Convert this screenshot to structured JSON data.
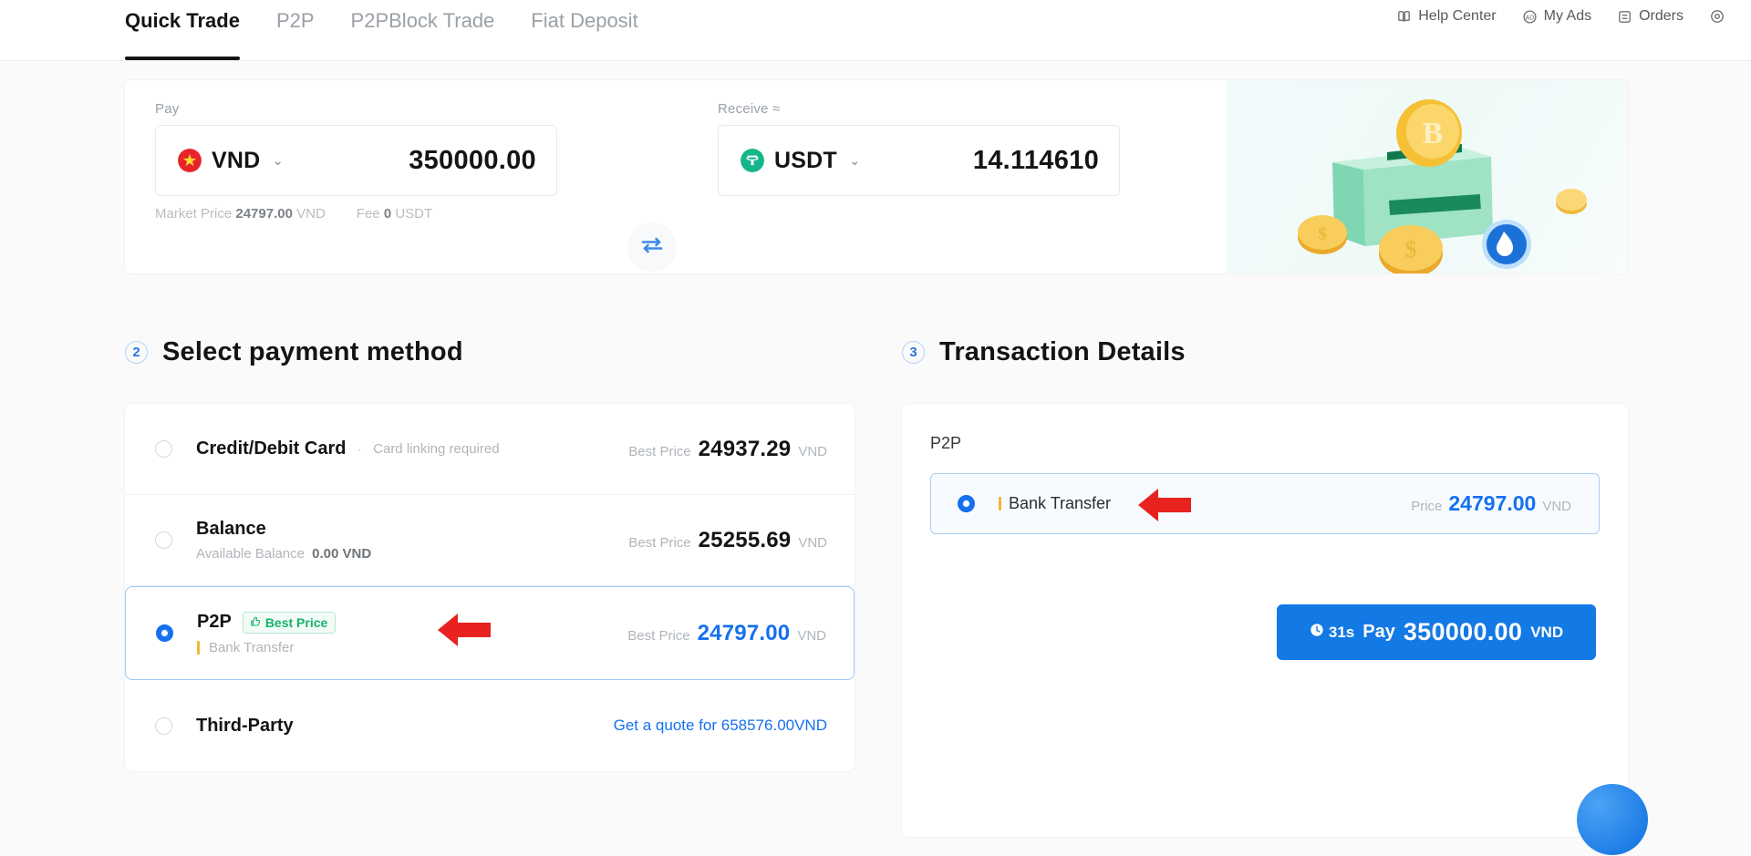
{
  "nav": {
    "tabs": [
      {
        "label": "Quick Trade",
        "active": true
      },
      {
        "label": "P2P",
        "active": false
      },
      {
        "label": "P2PBlock Trade",
        "active": false
      },
      {
        "label": "Fiat Deposit",
        "active": false
      }
    ],
    "right_items": [
      {
        "label": "Help Center",
        "icon": "book-icon"
      },
      {
        "label": "My Ads",
        "icon": "ads-icon"
      },
      {
        "label": "Orders",
        "icon": "orders-icon"
      }
    ],
    "settings_icon": "gear-icon"
  },
  "quote": {
    "pay": {
      "label": "Pay",
      "currency": "VND",
      "amount": "350000.00",
      "flag_icon": "vietnam-flag-icon"
    },
    "receive": {
      "label": "Receive ≈",
      "currency": "USDT",
      "amount": "14.114610",
      "coin_icon": "tether-icon"
    },
    "swap_icon": "swap-arrows-icon",
    "meta": {
      "market_price_label": "Market Price",
      "market_price_value": "24797.00",
      "market_price_unit": "VND",
      "fee_label": "Fee",
      "fee_value": "0",
      "fee_unit": "USDT"
    },
    "illustration": "money-box-coins-illustration"
  },
  "payment_section": {
    "step": "2",
    "title": "Select payment method",
    "methods": [
      {
        "name": "Credit/Debit Card",
        "separator": "·",
        "note": "Card linking required",
        "price_label": "Best Price",
        "price_value": "24937.29",
        "price_unit": "VND",
        "selected": false
      },
      {
        "name": "Balance",
        "sub_label": "Available Balance",
        "sub_value": "0.00 VND",
        "price_label": "Best Price",
        "price_value": "25255.69",
        "price_unit": "VND",
        "selected": false
      },
      {
        "name": "P2P",
        "badge": "Best Price",
        "badge_icon": "thumbs-up-icon",
        "sub_value": "Bank Transfer",
        "price_label": "Best Price",
        "price_value": "24797.00",
        "price_unit": "VND",
        "selected": true
      },
      {
        "name": "Third-Party",
        "link": "Get a quote for 658576.00VND",
        "selected": false
      }
    ]
  },
  "transaction_section": {
    "step": "3",
    "title": "Transaction Details",
    "method_label": "P2P",
    "offer": {
      "name": "Bank Transfer",
      "price_label": "Price",
      "price_value": "24797.00",
      "price_unit": "VND",
      "selected": true
    },
    "pay_button": {
      "timer": "31s",
      "timer_icon": "clock-icon",
      "word": "Pay",
      "amount": "350000.00",
      "currency": "VND"
    }
  },
  "annotations": {
    "arrow_payment_method": "red-arrow-pointing-left",
    "arrow_transaction_offer": "red-arrow-pointing-left"
  },
  "colors": {
    "accent_blue": "#1570ef",
    "button_blue": "#1379e4",
    "best_price_green": "#17b26a",
    "arrow_red": "#e8221f",
    "page_bg": "#fafafa"
  }
}
